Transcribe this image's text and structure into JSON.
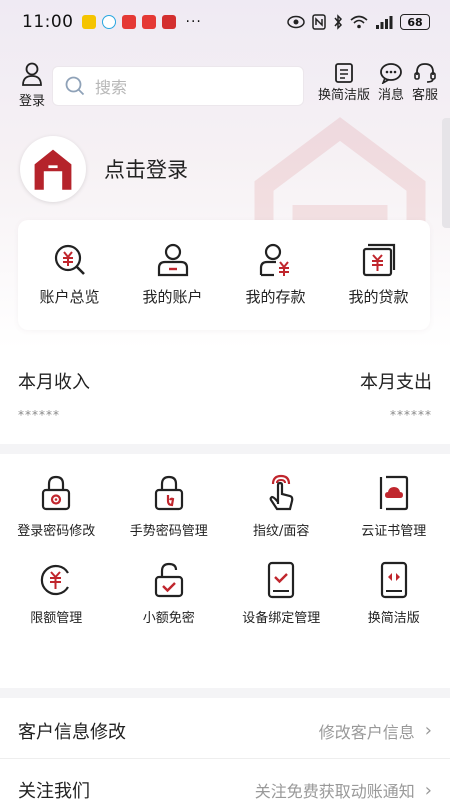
{
  "status_bar": {
    "time": "11:00",
    "dots": "···",
    "battery": "68"
  },
  "header": {
    "login_label": "登录",
    "search_placeholder": "搜索",
    "actions": [
      {
        "label": "换简洁版",
        "icon": "switch-simple-icon"
      },
      {
        "label": "消息",
        "icon": "message-icon"
      },
      {
        "label": "客服",
        "icon": "headset-icon"
      }
    ]
  },
  "profile": {
    "login_prompt": "点击登录"
  },
  "account_card": [
    {
      "label": "账户总览",
      "icon": "account-overview-icon"
    },
    {
      "label": "我的账户",
      "icon": "my-account-icon"
    },
    {
      "label": "我的存款",
      "icon": "my-deposit-icon"
    },
    {
      "label": "我的贷款",
      "icon": "my-loan-icon"
    }
  ],
  "month": {
    "income_label": "本月收入",
    "income_value": "******",
    "expense_label": "本月支出",
    "expense_value": "******"
  },
  "security": [
    {
      "label": "登录密码修改",
      "icon": "login-password-icon"
    },
    {
      "label": "手势密码管理",
      "icon": "gesture-password-icon"
    },
    {
      "label": "指纹/面容",
      "icon": "fingerprint-icon"
    },
    {
      "label": "云证书管理",
      "icon": "cloud-certificate-icon"
    },
    {
      "label": "限额管理",
      "icon": "limit-icon"
    },
    {
      "label": "小额免密",
      "icon": "small-amount-icon"
    },
    {
      "label": "设备绑定管理",
      "icon": "device-binding-icon"
    },
    {
      "label": "换简洁版",
      "icon": "simple-version-icon"
    }
  ],
  "list": [
    {
      "title": "客户信息修改",
      "subtitle": "修改客户信息"
    },
    {
      "title": "关注我们",
      "subtitle": "关注免费获取动账通知"
    }
  ],
  "colors": {
    "accent": "#c0262d",
    "icon": "#222222"
  }
}
